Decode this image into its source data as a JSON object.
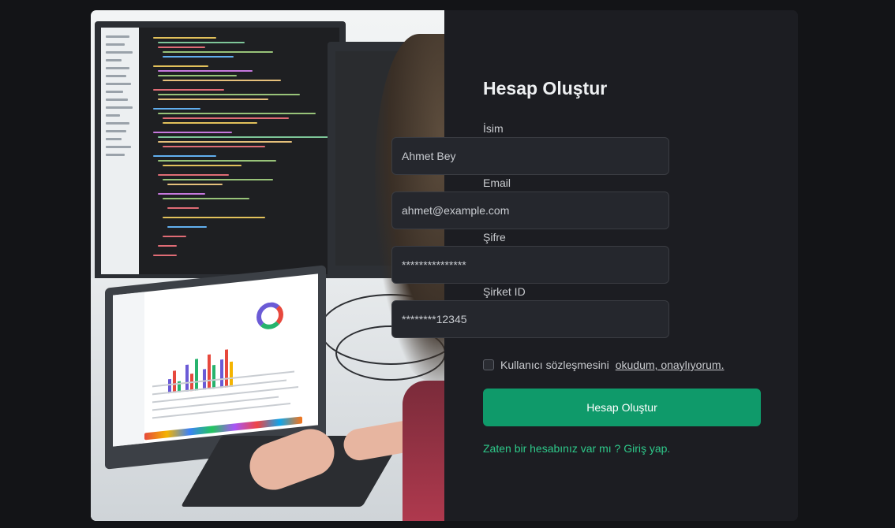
{
  "form": {
    "title": "Hesap Oluştur",
    "fields": [
      {
        "label": "İsim",
        "value": "Ahmet Bey"
      },
      {
        "label": "Email",
        "value": "ahmet@example.com"
      },
      {
        "label": "Şifre",
        "value": "***************"
      },
      {
        "label": "Şirket ID",
        "value": "********12345"
      }
    ],
    "terms_text": "Kullanıcı sözleşmesini",
    "terms_link": "okudum, onaylıyorum.",
    "submit_label": "Hesap Oluştur",
    "signin_text": "Zaten bir hesabınız var mı ? Giriş yap."
  },
  "theme": {
    "accent": "#0f9a6a",
    "link": "#2ec98a",
    "background": "#131417",
    "card": "#1c1d22"
  },
  "photo": {
    "subject": "developer-at-desk-photo"
  }
}
